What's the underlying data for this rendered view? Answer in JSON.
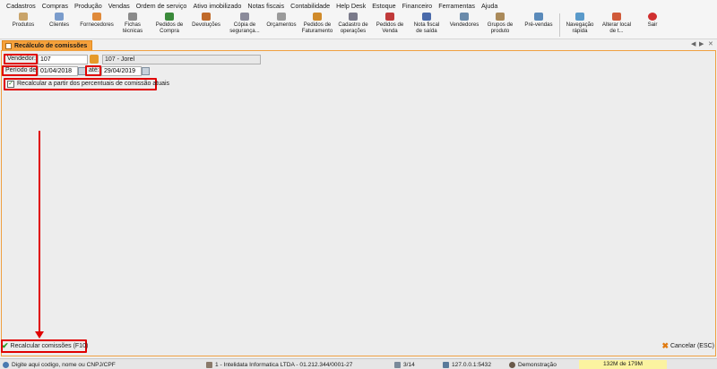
{
  "menu": [
    "Cadastros",
    "Compras",
    "Produção",
    "Vendas",
    "Ordem de serviço",
    "Ativo imobilizado",
    "Notas fiscais",
    "Contabilidade",
    "Help Desk",
    "Estoque",
    "Financeiro",
    "Ferramentas",
    "Ajuda"
  ],
  "toolbar": [
    {
      "l1": "Produtos",
      "l2": "",
      "icon": "box-icon",
      "color": "#c9a46a"
    },
    {
      "l1": "Clientes",
      "l2": "",
      "icon": "people-icon",
      "color": "#7a9ccc"
    },
    {
      "l1": "Fornecedores",
      "l2": "",
      "icon": "truck-icon",
      "color": "#e08a3a"
    },
    {
      "l1": "Fichas",
      "l2": "técnicas",
      "icon": "sheet-icon",
      "color": "#8a8a8a"
    },
    {
      "l1": "Pedidos de",
      "l2": "Compra",
      "icon": "cart-icon",
      "color": "#3a8a3a"
    },
    {
      "l1": "Devoluções",
      "l2": "",
      "icon": "return-icon",
      "color": "#c06a2a"
    },
    {
      "l1": "Cópia de",
      "l2": "segurança...",
      "icon": "copy-icon",
      "color": "#8a8a9a"
    },
    {
      "l1": "Orçamentos",
      "l2": "",
      "icon": "calc-icon",
      "color": "#9a9a9a"
    },
    {
      "l1": "Pedidos de",
      "l2": "Faturamento",
      "icon": "order-icon",
      "color": "#d08a2a"
    },
    {
      "l1": "Cadastro de",
      "l2": "operações",
      "icon": "grid-icon",
      "color": "#7a7a8a"
    },
    {
      "l1": "Pedidos de",
      "l2": "Venda",
      "icon": "sale-icon",
      "color": "#c03a3a"
    },
    {
      "l1": "Nota fiscal",
      "l2": "de saída",
      "icon": "invoice-icon",
      "color": "#4a6aaa"
    },
    {
      "l1": "Vendedores",
      "l2": "",
      "icon": "seller-icon",
      "color": "#6a8aaa"
    },
    {
      "l1": "Grupos de",
      "l2": "produto",
      "icon": "group-icon",
      "color": "#aa8a5a"
    },
    {
      "l1": "Pré-vendas",
      "l2": "",
      "icon": "presale-icon",
      "color": "#5a8aba"
    },
    {
      "l1": "Navegação",
      "l2": "rápida",
      "icon": "nav-icon",
      "color": "#5a9aca"
    },
    {
      "l1": "Alterar local",
      "l2": "de t...",
      "icon": "home-icon",
      "color": "#d05a3a"
    },
    {
      "l1": "Sair",
      "l2": "",
      "icon": "power-icon",
      "color": "#d03030"
    }
  ],
  "tab": {
    "label": "Recálculo de comissões"
  },
  "form": {
    "vendedor_label": "Vendedor:",
    "vendedor_value": "107",
    "vendedor_name": "107 - Jorel",
    "periodo_label": "Período de:",
    "periodo_from": "01/04/2018",
    "ate_label": "até:",
    "periodo_to": "29/04/2019",
    "checkbox_label": "Recalcular a partir dos percentuais de comissão atuais",
    "checkbox_checked": true
  },
  "actions": {
    "recalc": "Recalcular comissões (F10)",
    "cancel": "Cancelar (ESC)"
  },
  "status": {
    "hint": "Digite aqui codigo, nome ou CNPJ/CPF",
    "company": "1 - Intelidata Informatica LTDA - 01.212.344/0001-27",
    "count": "3/14",
    "server": "127.0.0.1:5432",
    "user": "Demonstração",
    "memory": "132M de 179M"
  }
}
